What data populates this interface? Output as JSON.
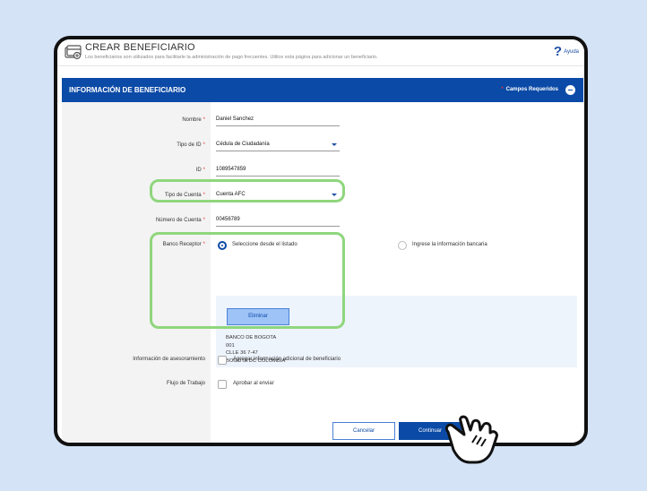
{
  "header": {
    "title": "CREAR BENEFICIARIO",
    "subtitle": "Los beneficiarios son utilizados para facilitarle la administración de pago frecuentes. Utilice esta página para adicionar un beneficiario.",
    "help_symbol": "?",
    "help_label": "Ayuda"
  },
  "section": {
    "title": "INFORMACIÓN DE BENEFICIARIO",
    "required_marker": "*",
    "required_label": "Campos Requeridos"
  },
  "form": {
    "nombre": {
      "label": "Nombre",
      "value": "Daniel Sanchez"
    },
    "tipo_id": {
      "label": "Tipo de ID",
      "value": "Cédula de Ciudadanía"
    },
    "id": {
      "label": "ID",
      "value": "1089547859"
    },
    "tipo_cuenta": {
      "label": "Tipo de Cuenta",
      "value": "Cuenta AFC"
    },
    "numero_cuenta": {
      "label": "Número de Cuenta",
      "value": "00456789"
    },
    "banco": {
      "label": "Banco Receptor",
      "option_list": "Seleccione desde el listado",
      "option_manual": "Ingrese la información bancaria",
      "selected": "Seleccione desde el listado",
      "eliminar_label": "Eliminar",
      "lines": [
        "BANCO DE BOGOTA",
        "001",
        "CLLE 36 7-47",
        "BOGOTA DC COLOMBIA"
      ]
    },
    "asesoramiento": {
      "label": "Información de asesoramiento",
      "checkbox_label": "Agregar información adicional de beneficiario",
      "checked": false
    },
    "flujo": {
      "label": "Flujo de Trabajo",
      "checkbox_label": "Aprobar al enviar",
      "checked": false
    },
    "required_star": "*"
  },
  "buttons": {
    "cancel": "Cancelar",
    "continue": "Continuar"
  },
  "colors": {
    "primary": "#0b4aa7",
    "highlight": "#8fd67d",
    "background": "#d4e3f6",
    "required": "#e53935"
  },
  "icons": {
    "page": "payee-card-icon",
    "help": "help-icon",
    "collapse": "minus-circle-icon",
    "pointer": "hand-pointer-icon",
    "dropdown": "chevron-down-icon"
  }
}
